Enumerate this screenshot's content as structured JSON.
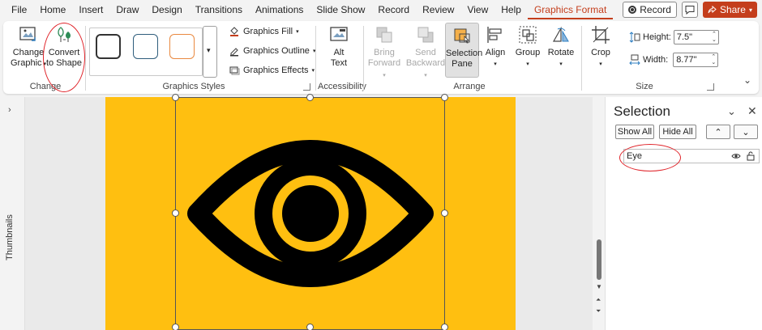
{
  "menu": {
    "items": [
      "File",
      "Home",
      "Insert",
      "Draw",
      "Design",
      "Transitions",
      "Animations",
      "Slide Show",
      "Record",
      "Review",
      "View",
      "Help",
      "Graphics Format"
    ],
    "active_index": 12,
    "record_label": "Record",
    "share_label": "Share"
  },
  "ribbon": {
    "change": {
      "label": "Change",
      "change_graphic_line1": "Change",
      "change_graphic_line2": "Graphic",
      "convert_line1": "Convert",
      "convert_line2": "to Shape"
    },
    "styles": {
      "label": "Graphics Styles",
      "fill": "Graphics Fill",
      "outline": "Graphics Outline",
      "effects": "Graphics Effects",
      "swatch_colors": [
        "#333333",
        "#2f5d7c",
        "#e98940"
      ]
    },
    "accessibility": {
      "label": "Accessibility",
      "alt_line1": "Alt",
      "alt_line2": "Text"
    },
    "arrange": {
      "label": "Arrange",
      "bring_line1": "Bring",
      "bring_line2": "Forward",
      "send_line1": "Send",
      "send_line2": "Backward",
      "selection_line1": "Selection",
      "selection_line2": "Pane",
      "align": "Align",
      "group": "Group",
      "rotate": "Rotate"
    },
    "size": {
      "label": "Size",
      "crop": "Crop",
      "height_label": "Height:",
      "height_value": "7.5\"",
      "width_label": "Width:",
      "width_value": "8.77\""
    }
  },
  "left_pane": {
    "label": "Thumbnails"
  },
  "slide": {
    "background": "#ffbf10",
    "icon": "eye-icon"
  },
  "selection_pane": {
    "title": "Selection",
    "show_all": "Show All",
    "hide_all": "Hide All",
    "items": [
      {
        "name": "Eye"
      }
    ]
  },
  "colors": {
    "accent": "#c43e1c",
    "annotation": "#e0242a"
  }
}
